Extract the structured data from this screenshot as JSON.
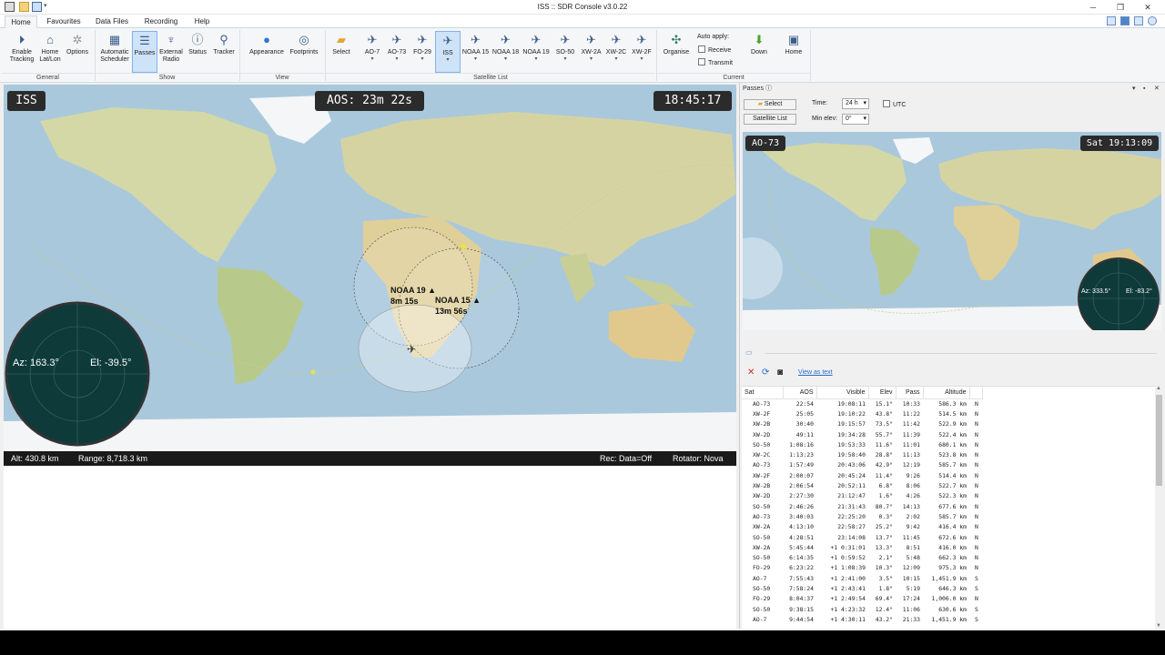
{
  "window": {
    "title": "ISS :: SDR Console v3.0.22",
    "minimize": "─",
    "restore": "❐",
    "close": "✕"
  },
  "tabs": [
    "Home",
    "Favourites",
    "Data Files",
    "Recording",
    "Help"
  ],
  "ribbon": {
    "general": {
      "label": "General",
      "buttons": [
        "Enable\nTracking",
        "Home\nLat/Lon",
        "Options"
      ]
    },
    "show": {
      "label": "Show",
      "buttons": [
        "Automatic\nScheduler",
        "Passes",
        "External\nRadio",
        "Status",
        "Tracker"
      ]
    },
    "view": {
      "label": "View",
      "buttons": [
        "Appearance",
        "Footprints"
      ]
    },
    "satlist": {
      "label": "Satellite List",
      "select": "Select",
      "sats": [
        "AO-7",
        "AO-73",
        "FO-29",
        "ISS",
        "NOAA 15",
        "NOAA 18",
        "NOAA 19",
        "SO-50",
        "XW-2A",
        "XW-2C",
        "XW-2F"
      ]
    },
    "current": {
      "label": "Current",
      "organise": "Organise",
      "auto_apply": "Auto apply:",
      "receive": "Receive",
      "transmit": "Transmit",
      "down": "Down",
      "home": "Home"
    }
  },
  "map": {
    "sat_name": "ISS",
    "aos": "AOS: 23m 22s",
    "clock": "18:45:17",
    "az": "Az: 163.3°",
    "el": "El: -39.5°",
    "noaa19_name": "NOAA 19 ▲",
    "noaa19_time": "8m 15s",
    "noaa15_name": "NOAA 15 ▲",
    "noaa15_time": "13m 56s",
    "alt": "Alt: 430.8 km",
    "range": "Range: 8,718.3 km",
    "rec": "Rec: Data=Off",
    "rotator": "Rotator: Nova"
  },
  "passes": {
    "title": "Passes",
    "select": "Select",
    "satellite_list": "Satellite List",
    "time_label": "Time:",
    "time_value": "24 h",
    "utc": "UTC",
    "min_elev_label": "Min elev:",
    "min_elev_value": "0°",
    "mini_sat": "AO-73",
    "mini_clock": "Sat 19:13:09",
    "mini_az": "Az: 333.5°",
    "mini_el": "El: -83.2°",
    "view_as_text": "View as text",
    "columns": [
      "Sat",
      "AOS",
      "Visible",
      "Elev",
      "Pass",
      "Altitude"
    ],
    "rows": [
      [
        "AO-73",
        "22:54",
        "19:08:11",
        "15.1°",
        "10:33",
        "586.3 km",
        "N"
      ],
      [
        "XW-2F",
        "25:05",
        "19:10:22",
        "43.8°",
        "11:22",
        "514.5 km",
        "N"
      ],
      [
        "XW-2B",
        "30:40",
        "19:15:57",
        "73.5°",
        "11:42",
        "522.9 km",
        "N"
      ],
      [
        "XW-2D",
        "49:11",
        "19:34:28",
        "55.7°",
        "11:39",
        "522.4 km",
        "N"
      ],
      [
        "SO-50",
        "1:08:16",
        "19:53:33",
        "11.6°",
        "11:01",
        "680.1 km",
        "N"
      ],
      [
        "XW-2C",
        "1:13:23",
        "19:58:40",
        "28.8°",
        "11:13",
        "523.8 km",
        "N"
      ],
      [
        "AO-73",
        "1:57:49",
        "20:43:06",
        "42.9°",
        "12:19",
        "585.7 km",
        "N"
      ],
      [
        "XW-2F",
        "2:00:07",
        "20:45:24",
        "11.4°",
        "9:26",
        "514.4 km",
        "N"
      ],
      [
        "XW-2B",
        "2:06:54",
        "20:52:11",
        "6.8°",
        "8:06",
        "522.7 km",
        "N"
      ],
      [
        "XW-2D",
        "2:27:30",
        "21:12:47",
        "1.6°",
        "4:26",
        "522.3 km",
        "N"
      ],
      [
        "SO-50",
        "2:46:26",
        "21:31:43",
        "80.7°",
        "14:13",
        "677.6 km",
        "N"
      ],
      [
        "AO-73",
        "3:40:03",
        "22:25:20",
        "0.3°",
        "2:02",
        "585.7 km",
        "N"
      ],
      [
        "XW-2A",
        "4:13:10",
        "22:58:27",
        "25.2°",
        "9:42",
        "416.4 km",
        "N"
      ],
      [
        "SO-50",
        "4:28:51",
        "23:14:08",
        "13.7°",
        "11:45",
        "672.6 km",
        "N"
      ],
      [
        "XW-2A",
        "5:45:44",
        "+1 0:31:01",
        "13.3°",
        "8:51",
        "416.0 km",
        "N"
      ],
      [
        "SO-50",
        "6:14:35",
        "+1 0:59:52",
        "2.1°",
        "5:48",
        "662.3 km",
        "N"
      ],
      [
        "FO-29",
        "6:23:22",
        "+1 1:08:39",
        "10.3°",
        "12:09",
        "975.3 km",
        "N"
      ],
      [
        "AO-7",
        "7:55:43",
        "+1 2:41:00",
        "3.5°",
        "10:15",
        "1,451.9 km",
        "S"
      ],
      [
        "SO-50",
        "7:58:24",
        "+1 2:43:41",
        "1.8°",
        "5:19",
        "646.3 km",
        "S"
      ],
      [
        "FO-29",
        "8:04:37",
        "+1 2:49:54",
        "69.4°",
        "17:24",
        "1,006.0 km",
        "N"
      ],
      [
        "SO-50",
        "9:38:15",
        "+1 4:23:32",
        "12.4°",
        "11:06",
        "630.6 km",
        "S"
      ],
      [
        "AO-7",
        "9:44:54",
        "+1 4:30:11",
        "43.2°",
        "21:33",
        "1,451.9 km",
        "S"
      ]
    ]
  },
  "colors": {
    "ribbon_selected": "#cfe3f8",
    "overlay": "#2b2b2b",
    "radar": "#0e3a3a",
    "sea": "#a9c8dc",
    "land": "#cfd7a2"
  }
}
